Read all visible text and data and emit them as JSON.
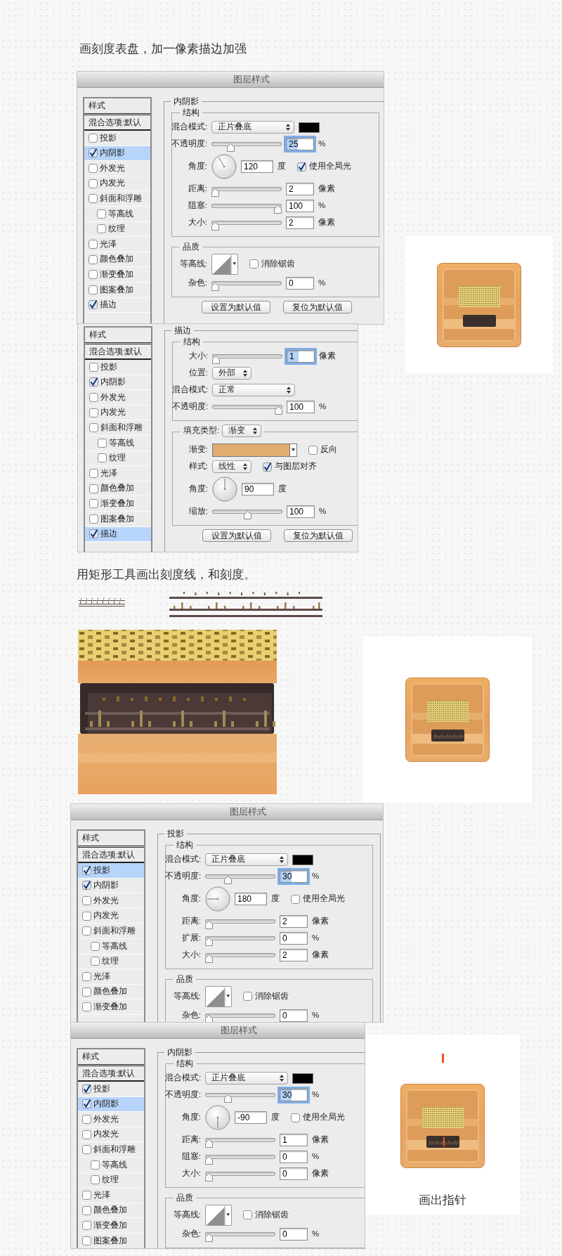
{
  "heading_stroke": "画刻度表盘，加一像素描边加强",
  "dialogs": [
    {
      "title": "图层样式",
      "styles_header": "样式",
      "blend_options": "混合选项:默认",
      "effects": [
        {
          "label": "投影",
          "checked": false,
          "selected": false
        },
        {
          "label": "内阴影",
          "checked": true,
          "selected": true
        },
        {
          "label": "外发光",
          "checked": false,
          "selected": false
        },
        {
          "label": "内发光",
          "checked": false,
          "selected": false
        },
        {
          "label": "斜面和浮雕",
          "checked": false,
          "selected": false,
          "children": [
            {
              "label": "等高线",
              "checked": false,
              "selected": false
            },
            {
              "label": "纹理",
              "checked": false,
              "selected": false
            }
          ]
        },
        {
          "label": "光泽",
          "checked": false,
          "selected": false
        },
        {
          "label": "颜色叠加",
          "checked": false,
          "selected": false
        },
        {
          "label": "渐变叠加",
          "checked": false,
          "selected": false
        },
        {
          "label": "图案叠加",
          "checked": false,
          "selected": false
        },
        {
          "label": "描边",
          "checked": true,
          "selected": false
        }
      ],
      "panel_legend": "内阴影",
      "groups": [
        {
          "legend": "结构",
          "rows": [
            {
              "label": "混合模式:",
              "controls": [
                {
                  "kind": "wide-select",
                  "value": "正片叠底"
                },
                {
                  "kind": "swatch",
                  "color": "#000000"
                }
              ]
            },
            {
              "label": "不透明度:",
              "controls": [
                {
                  "kind": "slider",
                  "level": 0.25
                },
                {
                  "kind": "field",
                  "value": "25",
                  "focused": true
                },
                {
                  "kind": "unit",
                  "text": "%"
                }
              ]
            },
            {
              "label": "角度:",
              "controls": [
                {
                  "kind": "dial"
                },
                {
                  "kind": "field",
                  "value": "120",
                  "focused": false
                },
                {
                  "kind": "unit",
                  "text": "度"
                },
                {
                  "kind": "checkbox",
                  "label": "使用全局光",
                  "checked": true
                }
              ]
            },
            {
              "label": "距离:",
              "controls": [
                {
                  "kind": "slider",
                  "level": 0
                },
                {
                  "kind": "field",
                  "value": "2",
                  "focused": false
                },
                {
                  "kind": "unit",
                  "text": "像素"
                }
              ]
            },
            {
              "label": "阻塞:",
              "controls": [
                {
                  "kind": "slider",
                  "level": 1
                },
                {
                  "kind": "field",
                  "value": "100",
                  "focused": false
                },
                {
                  "kind": "unit",
                  "text": "%"
                }
              ]
            },
            {
              "label": "大小:",
              "controls": [
                {
                  "kind": "slider",
                  "level": 0
                },
                {
                  "kind": "field",
                  "value": "2",
                  "focused": false
                },
                {
                  "kind": "unit",
                  "text": "像素"
                }
              ]
            }
          ]
        },
        {
          "legend": "品质",
          "rows": [
            {
              "label": "等高线:",
              "controls": [
                {
                  "kind": "contour"
                },
                {
                  "kind": "checkbox",
                  "label": "消除锯齿",
                  "checked": false
                }
              ]
            },
            {
              "label": "杂色:",
              "controls": [
                {
                  "kind": "slider",
                  "level": 0
                },
                {
                  "kind": "field",
                  "value": "0",
                  "focused": false
                },
                {
                  "kind": "unit",
                  "text": "%"
                }
              ]
            }
          ]
        }
      ],
      "buttons": [
        "设置为默认值",
        "复位为默认值"
      ]
    },
    {
      "styles_header": "样式",
      "blend_options": "混合选项:默认",
      "effects": [
        {
          "label": "投影",
          "checked": false,
          "selected": false
        },
        {
          "label": "内阴影",
          "checked": true,
          "selected": false
        },
        {
          "label": "外发光",
          "checked": false,
          "selected": false
        },
        {
          "label": "内发光",
          "checked": false,
          "selected": false
        },
        {
          "label": "斜面和浮雕",
          "checked": false,
          "selected": false,
          "children": [
            {
              "label": "等高线",
              "checked": false,
              "selected": false
            },
            {
              "label": "纹理",
              "checked": false,
              "selected": false
            }
          ]
        },
        {
          "label": "光泽",
          "checked": false,
          "selected": false
        },
        {
          "label": "颜色叠加",
          "checked": false,
          "selected": false
        },
        {
          "label": "渐变叠加",
          "checked": false,
          "selected": false
        },
        {
          "label": "图案叠加",
          "checked": false,
          "selected": false
        },
        {
          "label": "描边",
          "checked": true,
          "selected": true
        }
      ],
      "panel_legend": "描边",
      "groups": [
        {
          "legend": "结构",
          "rows": [
            {
              "label": "大小:",
              "controls": [
                {
                  "kind": "slider",
                  "level": 0
                },
                {
                  "kind": "field",
                  "value": "1",
                  "focused": true
                },
                {
                  "kind": "unit",
                  "text": "像素"
                }
              ]
            },
            {
              "label": "位置:",
              "controls": [
                {
                  "kind": "select",
                  "value": "外部"
                }
              ]
            },
            {
              "label": "混合模式:",
              "controls": [
                {
                  "kind": "wide-select",
                  "value": "正常"
                }
              ]
            },
            {
              "label": "不透明度:",
              "controls": [
                {
                  "kind": "slider",
                  "level": 1
                },
                {
                  "kind": "field",
                  "value": "100",
                  "focused": false
                },
                {
                  "kind": "unit",
                  "text": "%"
                }
              ]
            }
          ]
        },
        {
          "legend": "填充类型:",
          "legend_select": "渐变",
          "rows": [
            {
              "label": "渐变:",
              "controls": [
                {
                  "kind": "gradient",
                  "color": "#e0ac70"
                },
                {
                  "kind": "checkbox",
                  "label": "反向",
                  "checked": false
                }
              ]
            },
            {
              "label": "样式:",
              "controls": [
                {
                  "kind": "select",
                  "value": "线性"
                },
                {
                  "kind": "checkbox",
                  "label": "与图层对齐",
                  "checked": true
                }
              ]
            },
            {
              "label": "角度:",
              "controls": [
                {
                  "kind": "dial"
                },
                {
                  "kind": "field",
                  "value": "90",
                  "focused": false
                },
                {
                  "kind": "unit",
                  "text": "度"
                }
              ]
            },
            {
              "label": "缩放:",
              "controls": [
                {
                  "kind": "slider",
                  "level": 0.5
                },
                {
                  "kind": "field",
                  "value": "100",
                  "focused": false
                },
                {
                  "kind": "unit",
                  "text": "%"
                }
              ]
            }
          ]
        }
      ],
      "buttons": [
        "设置为默认值",
        "复位为默认值"
      ]
    },
    {
      "title": "图层样式",
      "styles_header": "样式",
      "blend_options": "混合选项:默认",
      "effects": [
        {
          "label": "投影",
          "checked": true,
          "selected": true
        },
        {
          "label": "内阴影",
          "checked": true,
          "selected": false
        },
        {
          "label": "外发光",
          "checked": false,
          "selected": false
        },
        {
          "label": "内发光",
          "checked": false,
          "selected": false
        },
        {
          "label": "斜面和浮雕",
          "checked": false,
          "selected": false,
          "children": [
            {
              "label": "等高线",
              "checked": false,
              "selected": false
            },
            {
              "label": "纹理",
              "checked": false,
              "selected": false
            }
          ]
        },
        {
          "label": "光泽",
          "checked": false,
          "selected": false
        },
        {
          "label": "颜色叠加",
          "checked": false,
          "selected": false
        },
        {
          "label": "渐变叠加",
          "checked": false,
          "selected": false
        }
      ],
      "panel_legend": "投影",
      "groups": [
        {
          "legend": "结构",
          "rows": [
            {
              "label": "混合模式:",
              "controls": [
                {
                  "kind": "wide-select",
                  "value": "正片叠底"
                },
                {
                  "kind": "swatch",
                  "color": "#000000"
                }
              ]
            },
            {
              "label": "不透明度:",
              "controls": [
                {
                  "kind": "slider",
                  "level": 0.3
                },
                {
                  "kind": "field",
                  "value": "30",
                  "focused": true
                },
                {
                  "kind": "unit",
                  "text": "%"
                }
              ]
            },
            {
              "label": "角度:",
              "controls": [
                {
                  "kind": "dial"
                },
                {
                  "kind": "field",
                  "value": "180",
                  "focused": false
                },
                {
                  "kind": "unit",
                  "text": "度"
                },
                {
                  "kind": "checkbox",
                  "label": "使用全局光",
                  "checked": false
                }
              ]
            },
            {
              "label": "距离:",
              "controls": [
                {
                  "kind": "slider",
                  "level": 0
                },
                {
                  "kind": "field",
                  "value": "2",
                  "focused": false
                },
                {
                  "kind": "unit",
                  "text": "像素"
                }
              ]
            },
            {
              "label": "扩展:",
              "controls": [
                {
                  "kind": "slider",
                  "level": 0
                },
                {
                  "kind": "field",
                  "value": "0",
                  "focused": false
                },
                {
                  "kind": "unit",
                  "text": "%"
                }
              ]
            },
            {
              "label": "大小:",
              "controls": [
                {
                  "kind": "slider",
                  "level": 0
                },
                {
                  "kind": "field",
                  "value": "2",
                  "focused": false
                },
                {
                  "kind": "unit",
                  "text": "像素"
                }
              ]
            }
          ]
        },
        {
          "legend": "品质",
          "rows": [
            {
              "label": "等高线:",
              "controls": [
                {
                  "kind": "contour"
                },
                {
                  "kind": "checkbox",
                  "label": "消除锯齿",
                  "checked": false
                }
              ]
            },
            {
              "label": "杂色:",
              "controls": [
                {
                  "kind": "slider",
                  "level": 0
                },
                {
                  "kind": "field",
                  "value": "0",
                  "focused": false
                },
                {
                  "kind": "unit",
                  "text": "%"
                }
              ]
            }
          ]
        }
      ]
    },
    {
      "title": "图层样式",
      "styles_header": "样式",
      "blend_options": "混合选项:默认",
      "effects": [
        {
          "label": "投影",
          "checked": true,
          "selected": false
        },
        {
          "label": "内阴影",
          "checked": true,
          "selected": true
        },
        {
          "label": "外发光",
          "checked": false,
          "selected": false
        },
        {
          "label": "内发光",
          "checked": false,
          "selected": false
        },
        {
          "label": "斜面和浮雕",
          "checked": false,
          "selected": false,
          "children": [
            {
              "label": "等高线",
              "checked": false,
              "selected": false
            },
            {
              "label": "纹理",
              "checked": false,
              "selected": false
            }
          ]
        },
        {
          "label": "光泽",
          "checked": false,
          "selected": false
        },
        {
          "label": "颜色叠加",
          "checked": false,
          "selected": false
        },
        {
          "label": "渐变叠加",
          "checked": false,
          "selected": false
        },
        {
          "label": "图案叠加",
          "checked": false,
          "selected": false
        }
      ],
      "panel_legend": "内阴影",
      "groups": [
        {
          "legend": "结构",
          "rows": [
            {
              "label": "混合模式:",
              "controls": [
                {
                  "kind": "wide-select",
                  "value": "正片叠底"
                },
                {
                  "kind": "swatch",
                  "color": "#000000"
                }
              ]
            },
            {
              "label": "不透明度:",
              "controls": [
                {
                  "kind": "slider",
                  "level": 0.3
                },
                {
                  "kind": "field",
                  "value": "30",
                  "focused": true
                },
                {
                  "kind": "unit",
                  "text": "%"
                }
              ]
            },
            {
              "label": "角度:",
              "controls": [
                {
                  "kind": "dial"
                },
                {
                  "kind": "field",
                  "value": "-90",
                  "focused": false
                },
                {
                  "kind": "unit",
                  "text": "度"
                },
                {
                  "kind": "checkbox",
                  "label": "使用全局光",
                  "checked": false
                }
              ]
            },
            {
              "label": "距离:",
              "controls": [
                {
                  "kind": "slider",
                  "level": 0
                },
                {
                  "kind": "field",
                  "value": "1",
                  "focused": false
                },
                {
                  "kind": "unit",
                  "text": "像素"
                }
              ]
            },
            {
              "label": "阻塞:",
              "controls": [
                {
                  "kind": "slider",
                  "level": 0
                },
                {
                  "kind": "field",
                  "value": "0",
                  "focused": false
                },
                {
                  "kind": "unit",
                  "text": "%"
                }
              ]
            },
            {
              "label": "大小:",
              "controls": [
                {
                  "kind": "slider",
                  "level": 0
                },
                {
                  "kind": "field",
                  "value": "0",
                  "focused": false
                },
                {
                  "kind": "unit",
                  "text": "像素"
                }
              ]
            }
          ]
        },
        {
          "legend": "品质",
          "rows": [
            {
              "label": "等高线:",
              "controls": [
                {
                  "kind": "contour"
                },
                {
                  "kind": "checkbox",
                  "label": "消除锯齿",
                  "checked": false
                }
              ]
            },
            {
              "label": "杂色:",
              "controls": [
                {
                  "kind": "slider",
                  "level": 0
                },
                {
                  "kind": "field",
                  "value": "0",
                  "focused": false
                },
                {
                  "kind": "unit",
                  "text": "%"
                }
              ]
            }
          ]
        }
      ]
    }
  ],
  "heading_scale": "用矩形工具画出刻度线，和刻度。",
  "previews": [
    {
      "scale_marks": false,
      "needle": false
    },
    {
      "scale_marks": true,
      "needle": false
    },
    {
      "scale_marks": true,
      "needle": true,
      "needle_sample": true,
      "caption": "画出指针"
    }
  ]
}
